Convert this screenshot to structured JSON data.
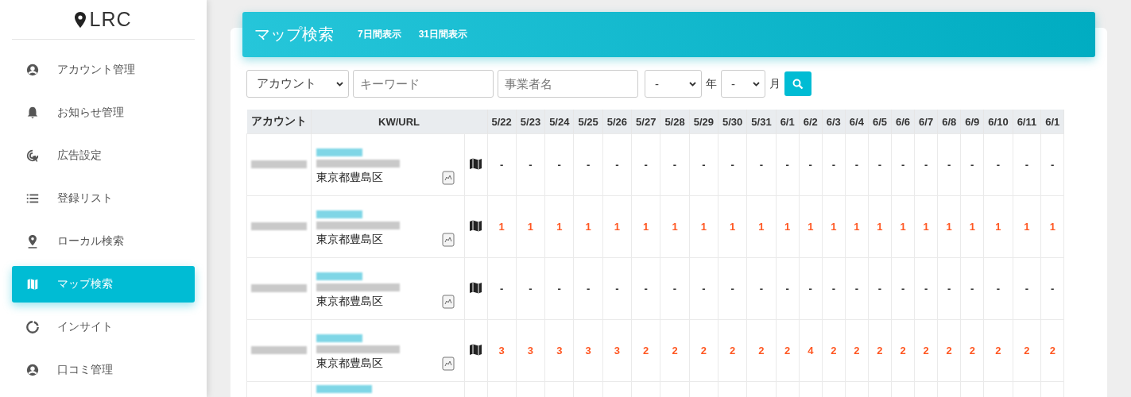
{
  "sidebar": {
    "logo": "LRC",
    "items": [
      {
        "label": "アカウント管理",
        "selected": false
      },
      {
        "label": "お知らせ管理",
        "selected": false
      },
      {
        "label": "広告設定",
        "selected": false
      },
      {
        "label": "登録リスト",
        "selected": false
      },
      {
        "label": "ローカル検索",
        "selected": false
      },
      {
        "label": "マップ検索",
        "selected": true
      },
      {
        "label": "インサイト",
        "selected": false
      },
      {
        "label": "口コミ管理",
        "selected": false
      }
    ]
  },
  "header": {
    "title": "マップ検索",
    "links": [
      "7日間表示",
      "31日間表示"
    ]
  },
  "filters": {
    "account_select": "アカウント",
    "keyword": {
      "placeholder": "キーワード"
    },
    "business": {
      "placeholder": "事業者名"
    },
    "year_select": "-",
    "year_label": "年",
    "month_select": "-",
    "month_label": "月"
  },
  "table": {
    "columns": [
      "アカウント",
      "KW/URL",
      "5/22",
      "5/23",
      "5/24",
      "5/25",
      "5/26",
      "5/27",
      "5/28",
      "5/29",
      "5/30",
      "5/31",
      "6/1",
      "6/2",
      "6/3",
      "6/4",
      "6/5",
      "6/6",
      "6/7",
      "6/8",
      "6/9",
      "6/10",
      "6/11",
      "6/1"
    ],
    "rows": [
      {
        "location": "東京都豊島区",
        "ranked": false,
        "values": [
          "-",
          "-",
          "-",
          "-",
          "-",
          "-",
          "-",
          "-",
          "-",
          "-",
          "-",
          "-",
          "-",
          "-",
          "-",
          "-",
          "-",
          "-",
          "-",
          "-",
          "-",
          "-"
        ]
      },
      {
        "location": "東京都豊島区",
        "ranked": true,
        "values": [
          "1",
          "1",
          "1",
          "1",
          "1",
          "1",
          "1",
          "1",
          "1",
          "1",
          "1",
          "1",
          "1",
          "1",
          "1",
          "1",
          "1",
          "1",
          "1",
          "1",
          "1",
          "1"
        ]
      },
      {
        "location": "東京都豊島区",
        "ranked": false,
        "values": [
          "-",
          "-",
          "-",
          "-",
          "-",
          "-",
          "-",
          "-",
          "-",
          "-",
          "-",
          "-",
          "-",
          "-",
          "-",
          "-",
          "-",
          "-",
          "-",
          "-",
          "-",
          "-"
        ]
      },
      {
        "location": "東京都豊島区",
        "ranked": true,
        "values": [
          "3",
          "3",
          "3",
          "3",
          "3",
          "2",
          "2",
          "2",
          "2",
          "2",
          "2",
          "4",
          "2",
          "2",
          "2",
          "2",
          "2",
          "2",
          "2",
          "2",
          "2",
          "2"
        ]
      }
    ]
  }
}
